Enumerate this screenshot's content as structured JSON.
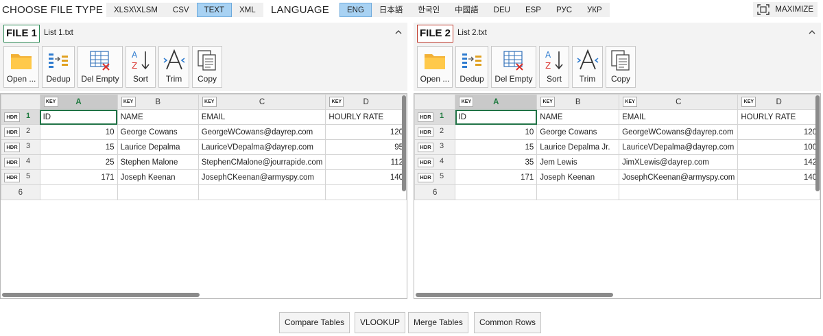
{
  "topbar": {
    "file_type_label": "CHOOSE FILE TYPE",
    "file_types": [
      "XLSX\\XLSM",
      "CSV",
      "TEXT",
      "XML"
    ],
    "file_type_selected": "TEXT",
    "language_label": "LANGUAGE",
    "languages": [
      "ENG",
      "日本語",
      "한국인",
      "中國語",
      "DEU",
      "ESP",
      "РУС",
      "УКР"
    ],
    "language_selected": "ENG",
    "maximize_label": "MAXIMIZE",
    "maximize_icon": "maximize-icon"
  },
  "panels": [
    {
      "badge": "FILE 1",
      "badge_color": "#2e8b57",
      "file_name": "List 1.txt",
      "tools": [
        {
          "label": "Open ...",
          "icon": "folder-icon"
        },
        {
          "label": "Dedup",
          "icon": "dedup-icon"
        },
        {
          "label": "Del Empty",
          "icon": "delete-empty-icon"
        },
        {
          "label": "Sort",
          "icon": "sort-icon"
        },
        {
          "label": "Trim",
          "icon": "trim-icon"
        },
        {
          "label": "Copy",
          "icon": "copy-icon"
        }
      ],
      "grid": {
        "key_label": "KEY",
        "hdr_label": "HDR",
        "columns": [
          "A",
          "B",
          "C",
          "D"
        ],
        "row_numbers": [
          "1",
          "2",
          "3",
          "4",
          "5",
          "6"
        ],
        "rows": [
          [
            "ID",
            "NAME",
            "EMAIL",
            "HOURLY RATE"
          ],
          [
            "10",
            "George Cowans",
            "GeorgeWCowans@dayrep.com",
            "120"
          ],
          [
            "15",
            "Laurice Depalma",
            "LauriceVDepalma@dayrep.com",
            "95"
          ],
          [
            "25",
            "Stephen Malone",
            "StephenCMalone@jourrapide.com",
            "112"
          ],
          [
            "171",
            "Joseph Keenan",
            "JosephCKeenan@armyspy.com",
            "140"
          ]
        ]
      }
    },
    {
      "badge": "FILE 2",
      "badge_color": "#c0392b",
      "file_name": "List 2.txt",
      "tools": [
        {
          "label": "Open ...",
          "icon": "folder-icon"
        },
        {
          "label": "Dedup",
          "icon": "dedup-icon"
        },
        {
          "label": "Del Empty",
          "icon": "delete-empty-icon"
        },
        {
          "label": "Sort",
          "icon": "sort-icon"
        },
        {
          "label": "Trim",
          "icon": "trim-icon"
        },
        {
          "label": "Copy",
          "icon": "copy-icon"
        }
      ],
      "grid": {
        "key_label": "KEY",
        "hdr_label": "HDR",
        "columns": [
          "A",
          "B",
          "C",
          "D"
        ],
        "row_numbers": [
          "1",
          "2",
          "3",
          "4",
          "5",
          "6"
        ],
        "rows": [
          [
            "ID",
            "NAME",
            "EMAIL",
            "HOURLY RATE"
          ],
          [
            "10",
            "George Cowans",
            "GeorgeWCowans@dayrep.com",
            "120"
          ],
          [
            "15",
            "Laurice Depalma Jr.",
            "LauriceVDepalma@dayrep.com",
            "100"
          ],
          [
            "35",
            "Jem Lewis",
            "JimXLewis@dayrep.com",
            "142"
          ],
          [
            "171",
            "Joseph Keenan",
            "JosephCKeenan@armyspy.com",
            "140"
          ]
        ]
      }
    }
  ],
  "actions": [
    "Compare Tables",
    "VLOOKUP",
    "Merge Tables",
    "Common Rows"
  ]
}
